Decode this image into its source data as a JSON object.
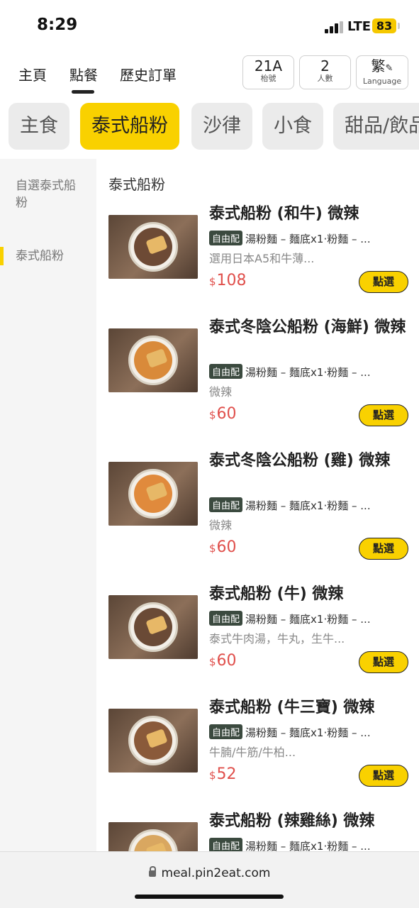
{
  "status_bar": {
    "time": "8:29",
    "network": "LTE",
    "battery": "83"
  },
  "top_nav": {
    "tabs": [
      "主頁",
      "點餐",
      "歷史訂單"
    ],
    "active_tab": "點餐",
    "table": {
      "value": "21A",
      "label": "枱號"
    },
    "people": {
      "value": "2",
      "label": "人數"
    },
    "language": {
      "value": "繁",
      "label": "Language"
    }
  },
  "categories": [
    "主食",
    "泰式船粉",
    "沙律",
    "小食",
    "甜品/飲品"
  ],
  "active_category": "泰式船粉",
  "sidebar": {
    "items": [
      "自選泰式船粉",
      "泰式船粉"
    ],
    "active": "泰式船粉"
  },
  "section_title": "泰式船粉",
  "menu_items": [
    {
      "name": "泰式船粉 (和牛) 微辣",
      "badge": "自由配",
      "options": "湯粉麵 – 麵底x1·粉麵 – ...",
      "desc": "選用日本A5和牛薄...",
      "currency": "$",
      "price": "108",
      "button": "點選"
    },
    {
      "name": "泰式冬陰公船粉 (海鮮) 微辣",
      "badge": "自由配",
      "options": "湯粉麵 – 麵底x1·粉麵 – ...",
      "desc": "微辣",
      "currency": "$",
      "price": "60",
      "button": "點選"
    },
    {
      "name": "泰式冬陰公船粉 (雞) 微辣",
      "badge": "自由配",
      "options": "湯粉麵 – 麵底x1·粉麵 – ...",
      "desc": "微辣",
      "currency": "$",
      "price": "60",
      "button": "點選"
    },
    {
      "name": "泰式船粉 (牛) 微辣",
      "badge": "自由配",
      "options": "湯粉麵 – 麵底x1·粉麵 – ...",
      "desc": "泰式牛肉湯，牛丸，生牛...",
      "currency": "$",
      "price": "60",
      "button": "點選"
    },
    {
      "name": "泰式船粉 (牛三寶) 微辣",
      "badge": "自由配",
      "options": "湯粉麵 – 麵底x1·粉麵 – ...",
      "desc": "牛腩/牛筋/牛柏...",
      "currency": "$",
      "price": "52",
      "button": "點選"
    },
    {
      "name": "泰式船粉 (辣雞絲) 微辣",
      "badge": "自由配",
      "options": "湯粉麵 – 麵底x1·粉麵 – ...",
      "desc": "",
      "currency": "$",
      "price": "",
      "button": ""
    }
  ],
  "url_bar": {
    "url": "meal.pin2eat.com"
  },
  "colors": {
    "accent": "#f9d100",
    "price": "#e0504c",
    "badge": "#3b4a3f"
  }
}
